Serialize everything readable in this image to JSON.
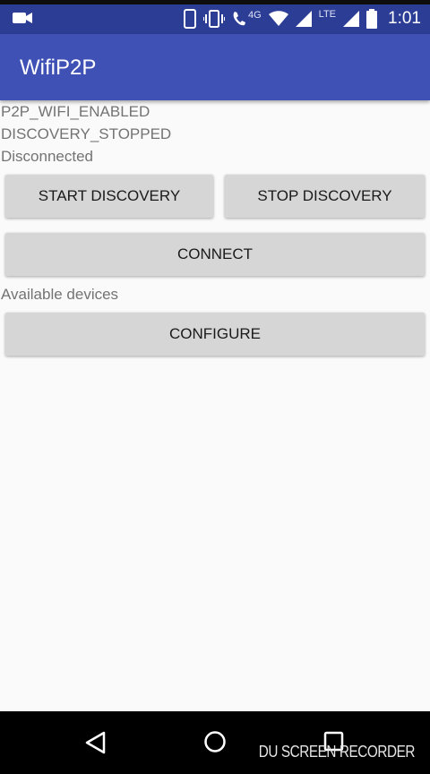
{
  "status_bar": {
    "network_label_4g": "4G",
    "network_label_lte": "LTE",
    "time": "1:01",
    "icons": [
      "video-camera-icon",
      "phone-portrait-icon",
      "vibrate-icon",
      "wifi-calling-icon",
      "wifi-icon",
      "signal-icon",
      "signal-icon",
      "battery-icon"
    ]
  },
  "app_bar": {
    "title": "WifiP2P"
  },
  "status": {
    "wifi_state": "P2P_WIFI_ENABLED",
    "discovery_state": "DISCOVERY_STOPPED",
    "connection_state": "Disconnected"
  },
  "buttons": {
    "start_discovery": "START DISCOVERY",
    "stop_discovery": "STOP DISCOVERY",
    "connect": "CONNECT",
    "configure": "CONFIGURE"
  },
  "devices": {
    "heading": "Available devices"
  },
  "nav_bar": {
    "icons": [
      "back-icon",
      "home-icon",
      "recents-icon"
    ]
  },
  "watermark": "DU SCREEN RECORDER",
  "colors": {
    "status_bar": "#2c3d96",
    "app_bar": "#3f51b5",
    "button": "#d6d6d6",
    "background": "#fafafa"
  }
}
